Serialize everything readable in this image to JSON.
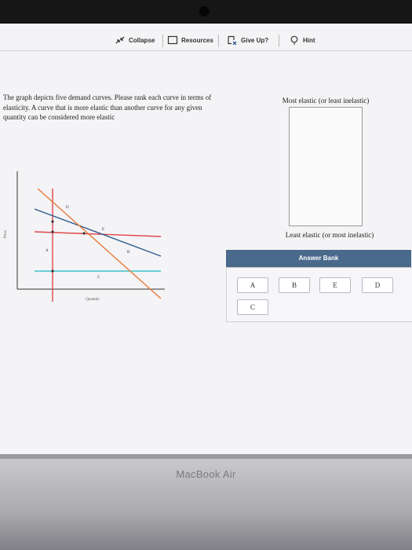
{
  "device": {
    "brand": "MacBook Air"
  },
  "toolbar": {
    "collapse_label": "Collapse",
    "resources_label": "Resources",
    "give_up_label": "Give Up?",
    "hint_label": "Hint"
  },
  "question": {
    "text": "The graph depicts five demand curves. Please rank each curve in terms of elasticity. A curve that is more elastic than another curve for any given quantity can be considered more elastic"
  },
  "graph": {
    "y_axis_label": "Price",
    "x_axis_label": "Quantity",
    "curves": [
      {
        "label": "D",
        "color": "#e8793a"
      },
      {
        "label": "E",
        "color": "#e0474c"
      },
      {
        "label": "A",
        "color": "#e0474c"
      },
      {
        "label": "B",
        "color": "#2c5a8c"
      },
      {
        "label": "C",
        "color": "#3cc4c8"
      }
    ]
  },
  "ranking": {
    "top_label": "Most elastic (or least inelastic)",
    "bottom_label": "Least elastic (or most inelastic)"
  },
  "answer_bank": {
    "title": "Answer Bank",
    "items": [
      "A",
      "B",
      "E",
      "D",
      "C"
    ]
  }
}
